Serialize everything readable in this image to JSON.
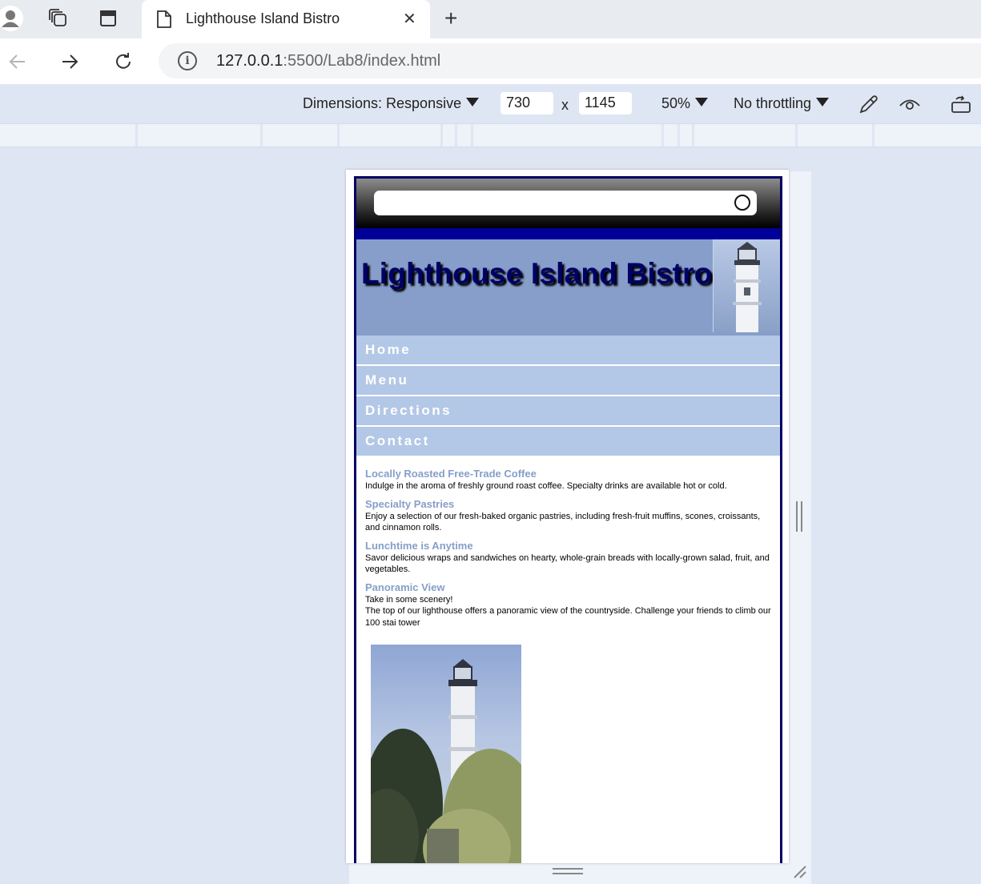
{
  "browser": {
    "tab": {
      "title": "Lighthouse Island Bistro"
    },
    "address": {
      "host": "127.0.0.1",
      "rest": ":5500/Lab8/index.html"
    }
  },
  "devtools": {
    "dimensions_label": "Dimensions: Responsive",
    "width": "730",
    "x_sep": "x",
    "height": "1145",
    "zoom": "50%",
    "throttling": "No throttling"
  },
  "page": {
    "title": "Lighthouse Island Bistro",
    "nav": [
      "Home",
      "Menu",
      "Directions",
      "Contact"
    ],
    "sections": [
      {
        "heading": "Locally Roasted Free-Trade Coffee",
        "text": [
          "Indulge in the aroma of freshly ground roast coffee. Specialty drinks are available hot or cold."
        ]
      },
      {
        "heading": "Specialty Pastries",
        "text": [
          "Enjoy a selection of our fresh-baked organic pastries, including fresh-fruit muffins, scones, croissants, and cinnamon rolls."
        ]
      },
      {
        "heading": "Lunchtime is Anytime",
        "text": [
          "Savor delicious wraps and sandwiches on hearty, whole-grain breads with locally-grown salad, fruit, and vegetables."
        ]
      },
      {
        "heading": "Panoramic View",
        "text": [
          "Take in some scenery!",
          "The top of our lighthouse offers a panoramic view of the countryside. Challenge your friends to climb our 100 stai tower"
        ]
      }
    ]
  },
  "colors": {
    "accent": "#869ec9",
    "nav_bg": "#b3c7e6",
    "border": "#000066",
    "heading": "#000066"
  },
  "icons": [
    "profile-icon",
    "workspaces-icon",
    "tab-actions-icon",
    "page-icon",
    "close-icon",
    "new-tab-icon",
    "back-icon",
    "forward-icon",
    "reload-icon",
    "info-icon",
    "caret-down-icon",
    "eyedropper-icon",
    "eye-icon",
    "rotate-icon"
  ]
}
